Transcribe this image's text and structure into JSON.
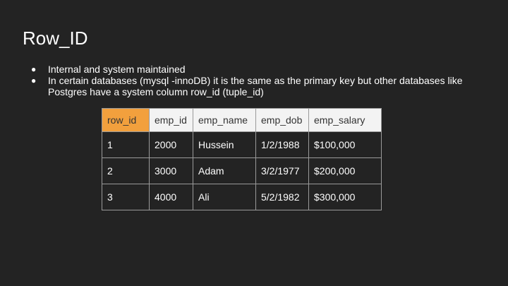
{
  "slide": {
    "title": "Row_ID",
    "bullets": [
      "Internal and system maintained",
      "In certain databases (mysql -innoDB) it is the same as the primary key but other databases like Postgres have a system column row_id (tuple_id)"
    ],
    "bullet_symbol": "●"
  },
  "table": {
    "highlight_color": "#f2a03d",
    "headers": [
      "row_id",
      "emp_id",
      "emp_name",
      "emp_dob",
      "emp_salary"
    ],
    "rows": [
      [
        "1",
        "2000",
        "Hussein",
        "1/2/1988",
        "$100,000"
      ],
      [
        "2",
        "3000",
        "Adam",
        "3/2/1977",
        "$200,000"
      ],
      [
        "3",
        "4000",
        "Ali",
        "5/2/1982",
        "$300,000"
      ]
    ]
  }
}
